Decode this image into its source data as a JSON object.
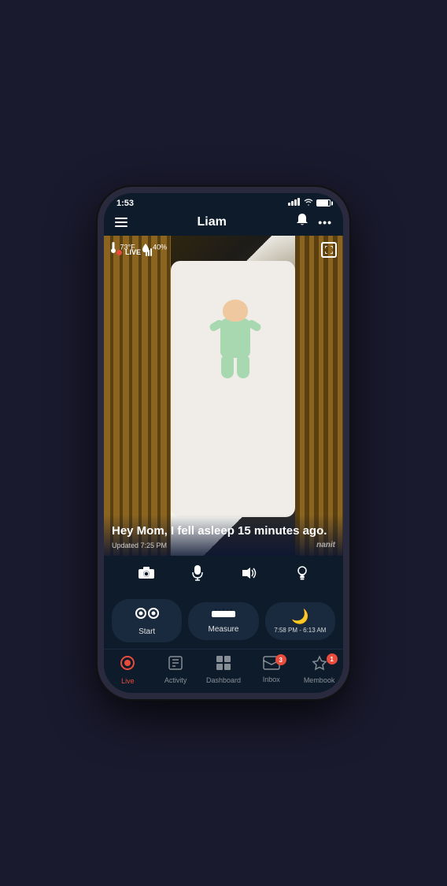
{
  "statusBar": {
    "time": "1:53",
    "signalBars": "▂▄▆",
    "wifi": "wifi",
    "battery": "battery"
  },
  "topNav": {
    "title": "Liam",
    "menuIcon": "☰",
    "bellIcon": "🔔",
    "moreIcon": "•••"
  },
  "cameraFeed": {
    "liveBadge": "LIVE",
    "temperature": "73°F",
    "humidity": "40%",
    "sleepMessage": "Hey Mom, I fell asleep 15 minutes ago.",
    "updatedText": "Updated 7:25 PM",
    "nanit": "nanit"
  },
  "controls": {
    "cameraIcon": "📷",
    "micIcon": "🎤",
    "soundIcon": "🔊",
    "lightIcon": "💡"
  },
  "actionButtons": {
    "start": {
      "icon": "👁",
      "label": "Start"
    },
    "measure": {
      "icon": "📏",
      "label": "Measure"
    },
    "sleep": {
      "time": "7:58 PM - 6:13 AM"
    }
  },
  "bottomNav": {
    "items": [
      {
        "id": "live",
        "label": "Live",
        "active": true,
        "badge": null
      },
      {
        "id": "activity",
        "label": "Activity",
        "active": false,
        "badge": null
      },
      {
        "id": "dashboard",
        "label": "Dashboard",
        "active": false,
        "badge": null
      },
      {
        "id": "inbox",
        "label": "Inbox",
        "active": false,
        "badge": "3"
      },
      {
        "id": "membook",
        "label": "Membook",
        "active": false,
        "badge": "1"
      }
    ]
  }
}
